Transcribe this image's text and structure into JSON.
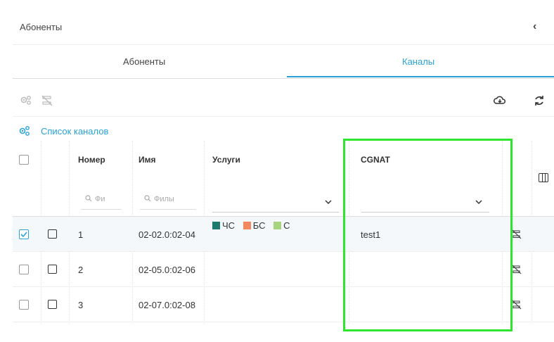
{
  "panel": {
    "title": "Абоненты",
    "collapse_glyph": "‹"
  },
  "tabs": [
    {
      "label": "Абоненты",
      "active": false
    },
    {
      "label": "Каналы",
      "active": true
    }
  ],
  "toolbar": {
    "left_icons": [
      "gears-icon",
      "unlink-icon"
    ],
    "right_icons": [
      "cloud-download-icon",
      "refresh-icon"
    ]
  },
  "list_title": "Список каналов",
  "columns": {
    "number": "Номер",
    "name": "Имя",
    "services": "Услуги",
    "cgnat": "CGNAT"
  },
  "filters": {
    "number_placeholder": "Фи",
    "name_placeholder": "Филы"
  },
  "rows": [
    {
      "checked": true,
      "number": "1",
      "name": "02-02.0:02-04",
      "cgnat": "test1",
      "services": [
        {
          "label": "ЧС",
          "color": "#1e7a6e"
        },
        {
          "label": "БС",
          "color": "#f4875d"
        },
        {
          "label": "С",
          "color": "#a9d47f"
        }
      ]
    },
    {
      "checked": false,
      "number": "2",
      "name": "02-05.0:02-06",
      "cgnat": "",
      "services": []
    },
    {
      "checked": false,
      "number": "3",
      "name": "02-07.0:02-08",
      "cgnat": "",
      "services": []
    }
  ],
  "colors": {
    "accent": "#29a3d6",
    "highlight_box": "#2ee62e"
  }
}
